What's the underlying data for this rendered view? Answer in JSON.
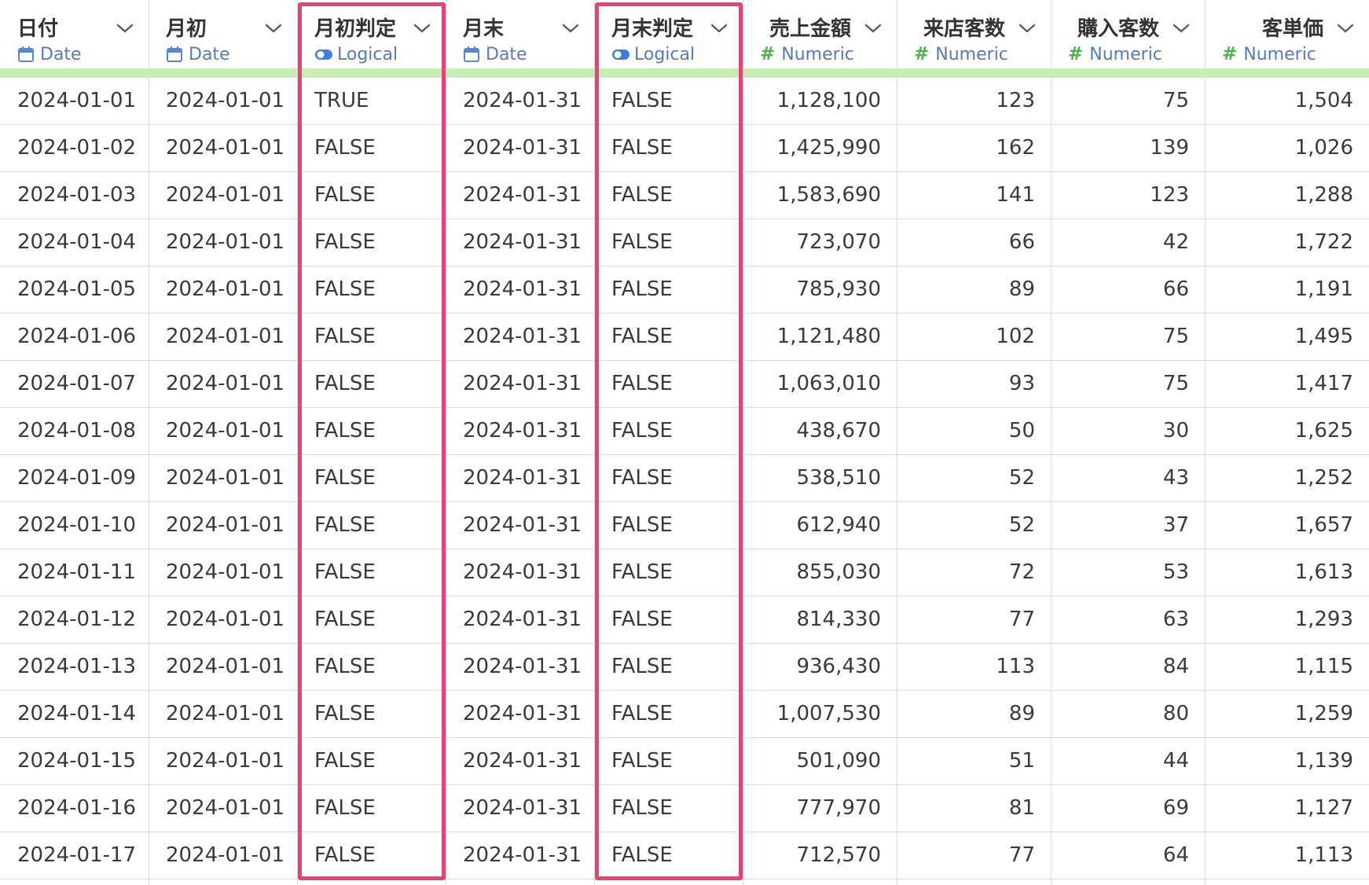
{
  "columns": [
    {
      "name": "日付",
      "type": "Date",
      "type_icon": "calendar-icon",
      "align": "left"
    },
    {
      "name": "月初",
      "type": "Date",
      "type_icon": "calendar-icon",
      "align": "left"
    },
    {
      "name": "月初判定",
      "type": "Logical",
      "type_icon": "toggle-icon",
      "align": "left"
    },
    {
      "name": "月末",
      "type": "Date",
      "type_icon": "calendar-icon",
      "align": "left"
    },
    {
      "name": "月末判定",
      "type": "Logical",
      "type_icon": "toggle-icon",
      "align": "left"
    },
    {
      "name": "売上金額",
      "type": "Numeric",
      "type_icon": "hash-icon",
      "align": "right"
    },
    {
      "name": "来店客数",
      "type": "Numeric",
      "type_icon": "hash-icon",
      "align": "right"
    },
    {
      "name": "購入客数",
      "type": "Numeric",
      "type_icon": "hash-icon",
      "align": "right"
    },
    {
      "name": "客単価",
      "type": "Numeric",
      "type_icon": "hash-icon",
      "align": "right"
    }
  ],
  "rows": [
    [
      "2024-01-01",
      "2024-01-01",
      "TRUE",
      "2024-01-31",
      "FALSE",
      "1,128,100",
      "123",
      "75",
      "1,504"
    ],
    [
      "2024-01-02",
      "2024-01-01",
      "FALSE",
      "2024-01-31",
      "FALSE",
      "1,425,990",
      "162",
      "139",
      "1,026"
    ],
    [
      "2024-01-03",
      "2024-01-01",
      "FALSE",
      "2024-01-31",
      "FALSE",
      "1,583,690",
      "141",
      "123",
      "1,288"
    ],
    [
      "2024-01-04",
      "2024-01-01",
      "FALSE",
      "2024-01-31",
      "FALSE",
      "723,070",
      "66",
      "42",
      "1,722"
    ],
    [
      "2024-01-05",
      "2024-01-01",
      "FALSE",
      "2024-01-31",
      "FALSE",
      "785,930",
      "89",
      "66",
      "1,191"
    ],
    [
      "2024-01-06",
      "2024-01-01",
      "FALSE",
      "2024-01-31",
      "FALSE",
      "1,121,480",
      "102",
      "75",
      "1,495"
    ],
    [
      "2024-01-07",
      "2024-01-01",
      "FALSE",
      "2024-01-31",
      "FALSE",
      "1,063,010",
      "93",
      "75",
      "1,417"
    ],
    [
      "2024-01-08",
      "2024-01-01",
      "FALSE",
      "2024-01-31",
      "FALSE",
      "438,670",
      "50",
      "30",
      "1,625"
    ],
    [
      "2024-01-09",
      "2024-01-01",
      "FALSE",
      "2024-01-31",
      "FALSE",
      "538,510",
      "52",
      "43",
      "1,252"
    ],
    [
      "2024-01-10",
      "2024-01-01",
      "FALSE",
      "2024-01-31",
      "FALSE",
      "612,940",
      "52",
      "37",
      "1,657"
    ],
    [
      "2024-01-11",
      "2024-01-01",
      "FALSE",
      "2024-01-31",
      "FALSE",
      "855,030",
      "72",
      "53",
      "1,613"
    ],
    [
      "2024-01-12",
      "2024-01-01",
      "FALSE",
      "2024-01-31",
      "FALSE",
      "814,330",
      "77",
      "63",
      "1,293"
    ],
    [
      "2024-01-13",
      "2024-01-01",
      "FALSE",
      "2024-01-31",
      "FALSE",
      "936,430",
      "113",
      "84",
      "1,115"
    ],
    [
      "2024-01-14",
      "2024-01-01",
      "FALSE",
      "2024-01-31",
      "FALSE",
      "1,007,530",
      "89",
      "80",
      "1,259"
    ],
    [
      "2024-01-15",
      "2024-01-01",
      "FALSE",
      "2024-01-31",
      "FALSE",
      "501,090",
      "51",
      "44",
      "1,139"
    ],
    [
      "2024-01-16",
      "2024-01-01",
      "FALSE",
      "2024-01-31",
      "FALSE",
      "777,970",
      "81",
      "69",
      "1,127"
    ],
    [
      "2024-01-17",
      "2024-01-01",
      "FALSE",
      "2024-01-31",
      "FALSE",
      "712,570",
      "77",
      "64",
      "1,113"
    ]
  ],
  "highlighted_columns": [
    "月初判定",
    "月末判定"
  ],
  "colors": {
    "highlight_border": "#e64273",
    "type_strip": "#c6eeb0",
    "numeric_hash": "#4bb34e",
    "type_label": "#5a7ab8",
    "grid_line": "#dcdcdc"
  }
}
